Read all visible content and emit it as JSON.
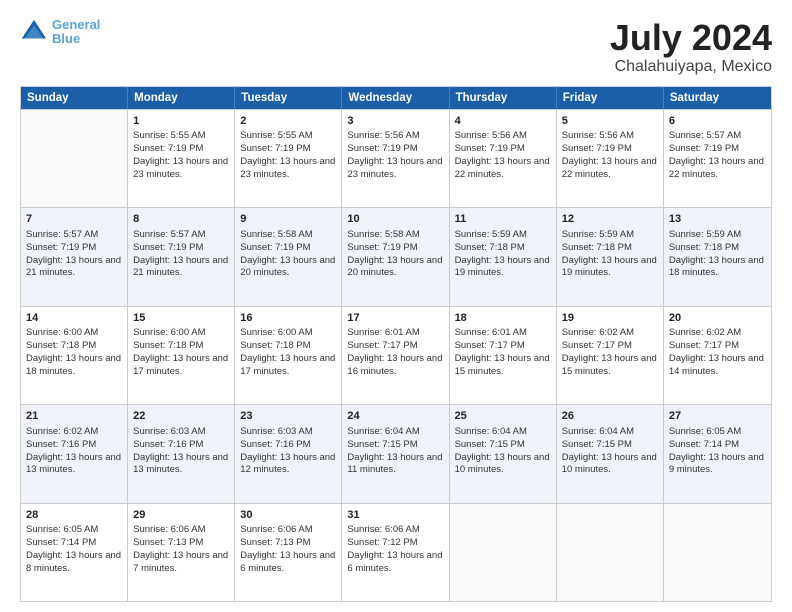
{
  "logo": {
    "line1": "General",
    "line2": "Blue"
  },
  "title": "July 2024",
  "subtitle": "Chalahuiyapa, Mexico",
  "days_of_week": [
    "Sunday",
    "Monday",
    "Tuesday",
    "Wednesday",
    "Thursday",
    "Friday",
    "Saturday"
  ],
  "weeks": [
    [
      {
        "day": "",
        "sunrise": "",
        "sunset": "",
        "daylight": ""
      },
      {
        "day": "1",
        "sunrise": "Sunrise: 5:55 AM",
        "sunset": "Sunset: 7:19 PM",
        "daylight": "Daylight: 13 hours and 23 minutes."
      },
      {
        "day": "2",
        "sunrise": "Sunrise: 5:55 AM",
        "sunset": "Sunset: 7:19 PM",
        "daylight": "Daylight: 13 hours and 23 minutes."
      },
      {
        "day": "3",
        "sunrise": "Sunrise: 5:56 AM",
        "sunset": "Sunset: 7:19 PM",
        "daylight": "Daylight: 13 hours and 23 minutes."
      },
      {
        "day": "4",
        "sunrise": "Sunrise: 5:56 AM",
        "sunset": "Sunset: 7:19 PM",
        "daylight": "Daylight: 13 hours and 22 minutes."
      },
      {
        "day": "5",
        "sunrise": "Sunrise: 5:56 AM",
        "sunset": "Sunset: 7:19 PM",
        "daylight": "Daylight: 13 hours and 22 minutes."
      },
      {
        "day": "6",
        "sunrise": "Sunrise: 5:57 AM",
        "sunset": "Sunset: 7:19 PM",
        "daylight": "Daylight: 13 hours and 22 minutes."
      }
    ],
    [
      {
        "day": "7",
        "sunrise": "Sunrise: 5:57 AM",
        "sunset": "Sunset: 7:19 PM",
        "daylight": "Daylight: 13 hours and 21 minutes."
      },
      {
        "day": "8",
        "sunrise": "Sunrise: 5:57 AM",
        "sunset": "Sunset: 7:19 PM",
        "daylight": "Daylight: 13 hours and 21 minutes."
      },
      {
        "day": "9",
        "sunrise": "Sunrise: 5:58 AM",
        "sunset": "Sunset: 7:19 PM",
        "daylight": "Daylight: 13 hours and 20 minutes."
      },
      {
        "day": "10",
        "sunrise": "Sunrise: 5:58 AM",
        "sunset": "Sunset: 7:19 PM",
        "daylight": "Daylight: 13 hours and 20 minutes."
      },
      {
        "day": "11",
        "sunrise": "Sunrise: 5:59 AM",
        "sunset": "Sunset: 7:18 PM",
        "daylight": "Daylight: 13 hours and 19 minutes."
      },
      {
        "day": "12",
        "sunrise": "Sunrise: 5:59 AM",
        "sunset": "Sunset: 7:18 PM",
        "daylight": "Daylight: 13 hours and 19 minutes."
      },
      {
        "day": "13",
        "sunrise": "Sunrise: 5:59 AM",
        "sunset": "Sunset: 7:18 PM",
        "daylight": "Daylight: 13 hours and 18 minutes."
      }
    ],
    [
      {
        "day": "14",
        "sunrise": "Sunrise: 6:00 AM",
        "sunset": "Sunset: 7:18 PM",
        "daylight": "Daylight: 13 hours and 18 minutes."
      },
      {
        "day": "15",
        "sunrise": "Sunrise: 6:00 AM",
        "sunset": "Sunset: 7:18 PM",
        "daylight": "Daylight: 13 hours and 17 minutes."
      },
      {
        "day": "16",
        "sunrise": "Sunrise: 6:00 AM",
        "sunset": "Sunset: 7:18 PM",
        "daylight": "Daylight: 13 hours and 17 minutes."
      },
      {
        "day": "17",
        "sunrise": "Sunrise: 6:01 AM",
        "sunset": "Sunset: 7:17 PM",
        "daylight": "Daylight: 13 hours and 16 minutes."
      },
      {
        "day": "18",
        "sunrise": "Sunrise: 6:01 AM",
        "sunset": "Sunset: 7:17 PM",
        "daylight": "Daylight: 13 hours and 15 minutes."
      },
      {
        "day": "19",
        "sunrise": "Sunrise: 6:02 AM",
        "sunset": "Sunset: 7:17 PM",
        "daylight": "Daylight: 13 hours and 15 minutes."
      },
      {
        "day": "20",
        "sunrise": "Sunrise: 6:02 AM",
        "sunset": "Sunset: 7:17 PM",
        "daylight": "Daylight: 13 hours and 14 minutes."
      }
    ],
    [
      {
        "day": "21",
        "sunrise": "Sunrise: 6:02 AM",
        "sunset": "Sunset: 7:16 PM",
        "daylight": "Daylight: 13 hours and 13 minutes."
      },
      {
        "day": "22",
        "sunrise": "Sunrise: 6:03 AM",
        "sunset": "Sunset: 7:16 PM",
        "daylight": "Daylight: 13 hours and 13 minutes."
      },
      {
        "day": "23",
        "sunrise": "Sunrise: 6:03 AM",
        "sunset": "Sunset: 7:16 PM",
        "daylight": "Daylight: 13 hours and 12 minutes."
      },
      {
        "day": "24",
        "sunrise": "Sunrise: 6:04 AM",
        "sunset": "Sunset: 7:15 PM",
        "daylight": "Daylight: 13 hours and 11 minutes."
      },
      {
        "day": "25",
        "sunrise": "Sunrise: 6:04 AM",
        "sunset": "Sunset: 7:15 PM",
        "daylight": "Daylight: 13 hours and 10 minutes."
      },
      {
        "day": "26",
        "sunrise": "Sunrise: 6:04 AM",
        "sunset": "Sunset: 7:15 PM",
        "daylight": "Daylight: 13 hours and 10 minutes."
      },
      {
        "day": "27",
        "sunrise": "Sunrise: 6:05 AM",
        "sunset": "Sunset: 7:14 PM",
        "daylight": "Daylight: 13 hours and 9 minutes."
      }
    ],
    [
      {
        "day": "28",
        "sunrise": "Sunrise: 6:05 AM",
        "sunset": "Sunset: 7:14 PM",
        "daylight": "Daylight: 13 hours and 8 minutes."
      },
      {
        "day": "29",
        "sunrise": "Sunrise: 6:06 AM",
        "sunset": "Sunset: 7:13 PM",
        "daylight": "Daylight: 13 hours and 7 minutes."
      },
      {
        "day": "30",
        "sunrise": "Sunrise: 6:06 AM",
        "sunset": "Sunset: 7:13 PM",
        "daylight": "Daylight: 13 hours and 6 minutes."
      },
      {
        "day": "31",
        "sunrise": "Sunrise: 6:06 AM",
        "sunset": "Sunset: 7:12 PM",
        "daylight": "Daylight: 13 hours and 6 minutes."
      },
      {
        "day": "",
        "sunrise": "",
        "sunset": "",
        "daylight": ""
      },
      {
        "day": "",
        "sunrise": "",
        "sunset": "",
        "daylight": ""
      },
      {
        "day": "",
        "sunrise": "",
        "sunset": "",
        "daylight": ""
      }
    ]
  ]
}
